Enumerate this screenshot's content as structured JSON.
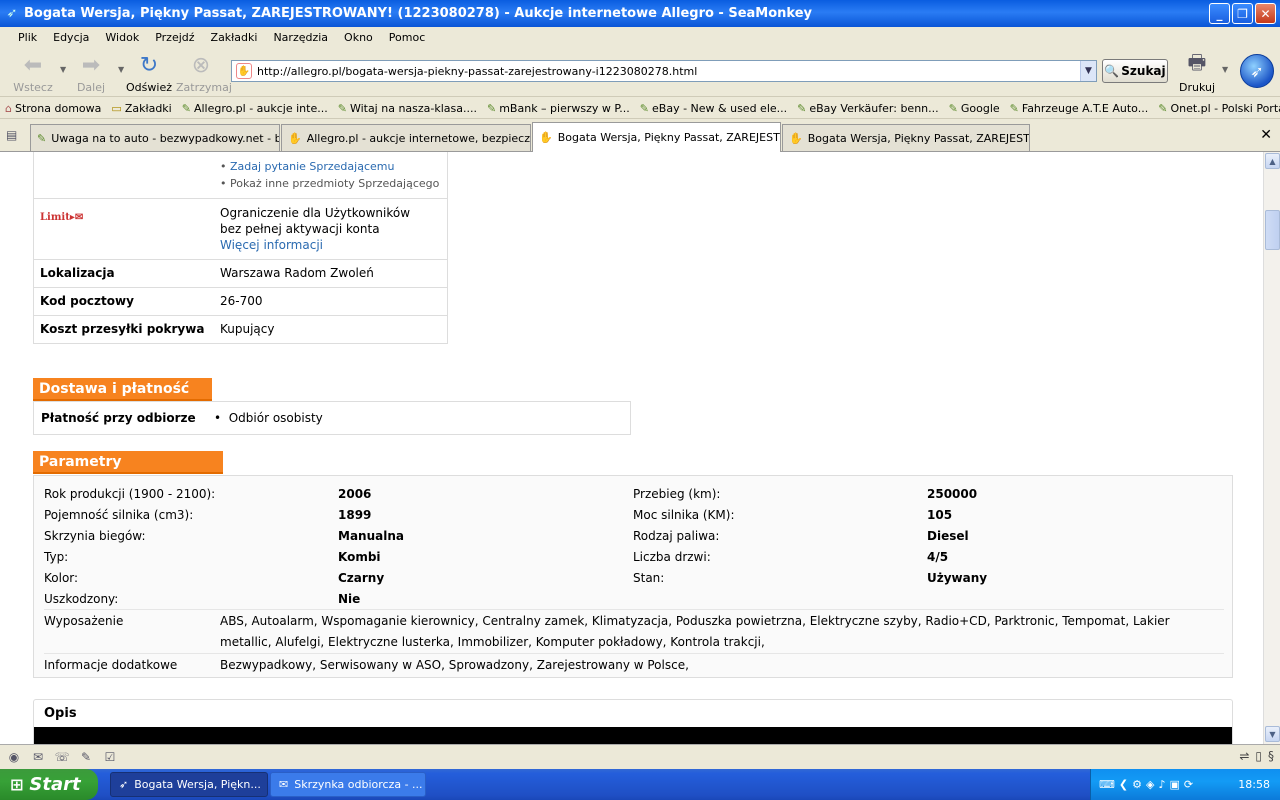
{
  "window": {
    "title": "Bogata Wersja, Piękny Passat, ZAREJESTROWANY! (1223080278) - Aukcje internetowe Allegro - SeaMonkey"
  },
  "menu": [
    "Plik",
    "Edycja",
    "Widok",
    "Przejdź",
    "Zakładki",
    "Narzędzia",
    "Okno",
    "Pomoc"
  ],
  "nav": {
    "back": "Wstecz",
    "forward": "Dalej",
    "reload": "Odśwież",
    "stop": "Zatrzymaj",
    "url": "http://allegro.pl/bogata-wersja-piekny-passat-zarejestrowany-i1223080278.html",
    "search": "Szukaj",
    "print": "Drukuj"
  },
  "bookmarks": [
    "Strona domowa",
    "Zakładki",
    "Allegro.pl - aukcje inte...",
    "Witaj na nasza-klasa....",
    "mBank – pierwszy w P...",
    "eBay - New & used ele...",
    "eBay Verkäufer: benn...",
    "Google",
    "Fahrzeuge A.T.E Auto...",
    "Onet.pl - Polski Portal ..."
  ],
  "tabs": [
    "Uwaga na to auto - bezwypadkowy.net - be...",
    "Allegro.pl - aukcje internetowe, bezpieczne ...",
    "Bogata Wersja, Piękny Passat, ZAREJESTR...",
    "Bogata Wersja, Piękny Passat, ZAREJESTR..."
  ],
  "seller": {
    "links": [
      "Zadaj pytanie Sprzedającemu",
      "Pokaż inne przedmioty Sprzedającego"
    ],
    "limit_label": "Limit",
    "limit_text1": "Ograniczenie dla Użytkowników",
    "limit_text2": "bez pełnej aktywacji konta",
    "limit_link": "Więcej informacji",
    "rows": [
      {
        "label": "Lokalizacja",
        "value": "Warszawa Radom Zwoleń"
      },
      {
        "label": "Kod pocztowy",
        "value": "26-700"
      },
      {
        "label": "Koszt przesyłki pokrywa",
        "value": "Kupujący"
      }
    ]
  },
  "delivery": {
    "heading": "Dostawa i płatność",
    "label": "Płatność przy odbiorze",
    "value": "Odbiór osobisty"
  },
  "params": {
    "heading": "Parametry",
    "rows": [
      {
        "k1": "Rok produkcji (1900 - 2100):",
        "v1": "2006",
        "k2": "Przebieg (km):",
        "v2": "250000"
      },
      {
        "k1": "Pojemność silnika (cm3):",
        "v1": "1899",
        "k2": "Moc silnika (KM):",
        "v2": "105"
      },
      {
        "k1": "Skrzynia biegów:",
        "v1": "Manualna",
        "k2": "Rodzaj paliwa:",
        "v2": "Diesel"
      },
      {
        "k1": "Typ:",
        "v1": "Kombi",
        "k2": "Liczba drzwi:",
        "v2": "4/5"
      },
      {
        "k1": "Kolor:",
        "v1": "Czarny",
        "k2": "Stan:",
        "v2": "Używany"
      },
      {
        "k1": "Uszkodzony:",
        "v1": "Nie",
        "k2": "",
        "v2": ""
      }
    ],
    "equipment_label": "Wyposażenie",
    "equipment": "ABS, Autoalarm, Wspomaganie kierownicy, Centralny zamek, Klimatyzacja, Poduszka powietrzna, Elektryczne szyby, Radio+CD, Parktronic, Tempomat, Lakier metallic, Alufelgi, Elektryczne lusterka, Immobilizer, Komputer pokładowy, Kontrola trakcji,",
    "extra_label": "Informacje dodatkowe",
    "extra": "Bezwypadkowy, Serwisowany w ASO, Sprowadzony, Zarejestrowany w Polsce,"
  },
  "opis": {
    "heading": "Opis"
  },
  "taskbar": {
    "start": "Start",
    "items": [
      "Bogata Wersja, Piękn...",
      "Skrzynka odbiorcza - ..."
    ],
    "clock": "18:58"
  }
}
